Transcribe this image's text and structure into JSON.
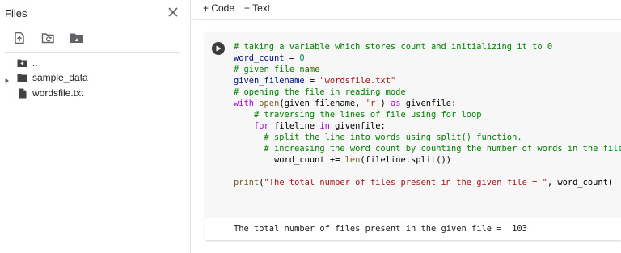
{
  "sidebar": {
    "title": "Files",
    "toolbar_icons": [
      "upload-file-icon",
      "refresh-folder-icon",
      "mount-drive-icon"
    ],
    "items": [
      {
        "label": "..",
        "icon": "parent-folder-icon",
        "expandable": false
      },
      {
        "label": "sample_data",
        "icon": "folder-icon",
        "expandable": true
      },
      {
        "label": "wordsfile.txt",
        "icon": "file-icon",
        "expandable": false
      }
    ]
  },
  "toolbar": {
    "code_label": "+ Code",
    "text_label": "+ Text"
  },
  "cell": {
    "lines": [
      [
        {
          "t": "# taking a variable which stores count and initializing it to 0",
          "c": "comment"
        }
      ],
      [
        {
          "t": "word_count",
          "c": "var"
        },
        {
          "t": " = ",
          "c": "plain"
        },
        {
          "t": "0",
          "c": "number"
        }
      ],
      [
        {
          "t": "# given file name",
          "c": "comment"
        }
      ],
      [
        {
          "t": "given_filename",
          "c": "var"
        },
        {
          "t": " = ",
          "c": "plain"
        },
        {
          "t": "\"wordsfile.txt\"",
          "c": "string"
        }
      ],
      [
        {
          "t": "# opening the file in reading mode",
          "c": "comment"
        }
      ],
      [
        {
          "t": "with",
          "c": "kwctrl"
        },
        {
          "t": " ",
          "c": "plain"
        },
        {
          "t": "open",
          "c": "builtin"
        },
        {
          "t": "(given_filename, ",
          "c": "plain"
        },
        {
          "t": "'r'",
          "c": "string"
        },
        {
          "t": ") ",
          "c": "plain"
        },
        {
          "t": "as",
          "c": "kwctrl"
        },
        {
          "t": " givenfile:",
          "c": "plain"
        }
      ],
      [
        {
          "t": "    # traversing the lines of file using for loop",
          "c": "comment"
        }
      ],
      [
        {
          "t": "    ",
          "c": "plain"
        },
        {
          "t": "for",
          "c": "kwctrl"
        },
        {
          "t": " fileline ",
          "c": "plain"
        },
        {
          "t": "in",
          "c": "kwctrl"
        },
        {
          "t": " givenfile:",
          "c": "plain"
        }
      ],
      [
        {
          "t": "      # split the line into words using split() function.",
          "c": "comment"
        }
      ],
      [
        {
          "t": "      # increasing the word count by counting the number of words in the file",
          "c": "comment"
        }
      ],
      [
        {
          "t": "        word_count += ",
          "c": "plain"
        },
        {
          "t": "len",
          "c": "builtin"
        },
        {
          "t": "(fileline.split())",
          "c": "plain"
        }
      ],
      [
        {
          "t": "",
          "c": "plain"
        }
      ],
      [
        {
          "t": "print",
          "c": "builtin"
        },
        {
          "t": "(",
          "c": "plain"
        },
        {
          "t": "\"The total number of files present in the given file = \"",
          "c": "string"
        },
        {
          "t": ", word_count)",
          "c": "plain"
        }
      ]
    ],
    "output": "The total number of files present in the given file =  103"
  }
}
